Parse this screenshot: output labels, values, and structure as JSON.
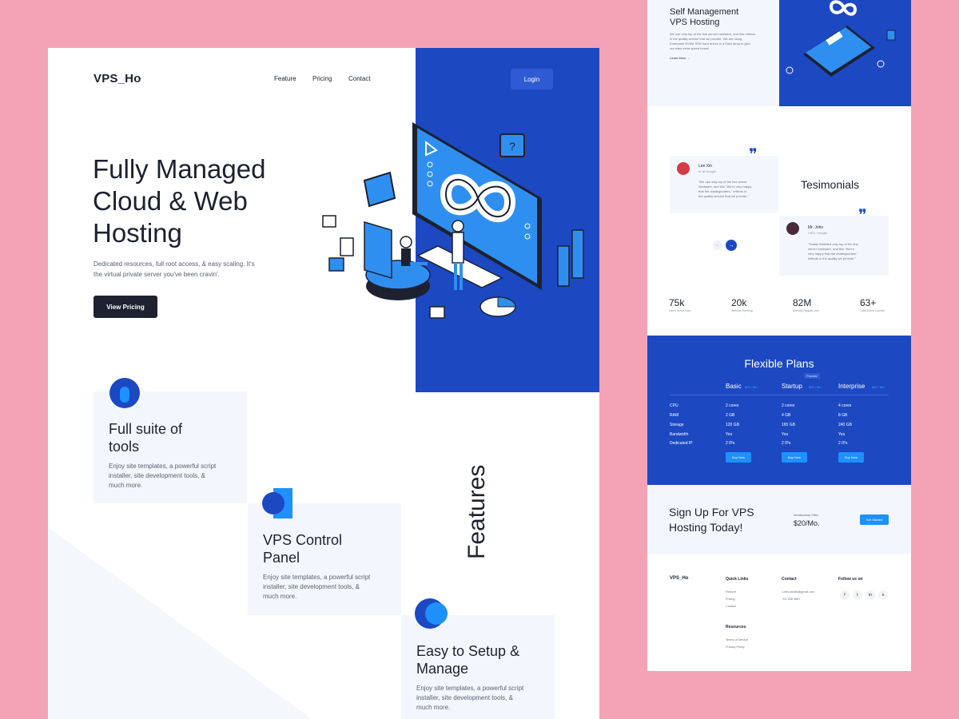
{
  "left": {
    "logo": "VPS_Ho",
    "nav": [
      "Feature",
      "Pricing",
      "Contact"
    ],
    "login": "Login",
    "hero": {
      "title_lines": [
        "Fully Managed",
        "Cloud & Web",
        "Hosting"
      ],
      "desc_lines": [
        "Dedicated resources, full root access, & easy scaling. It's",
        "the virtual private server you've been cravin'."
      ],
      "button": "View Pricing"
    },
    "features_heading": "Features",
    "features": [
      {
        "title_lines": [
          "Full suite of",
          "tools"
        ],
        "desc_lines": [
          "Enjoy site templates, a powerful script",
          "installer, site development tools, &",
          "much more."
        ],
        "icon": "toolbox-icon"
      },
      {
        "title_lines": [
          "VPS Control",
          "Panel"
        ],
        "desc_lines": [
          "Enjoy site templates, a powerful script",
          "installer, site development tools, &",
          "much more."
        ],
        "icon": "control-panel-icon"
      },
      {
        "title_lines": [
          "Easy to Setup &",
          "Manage"
        ],
        "desc_lines": [
          "Enjoy site templates, a powerful script",
          "installer, site development tools, &",
          "much more."
        ],
        "icon": "setup-icon"
      }
    ]
  },
  "right": {
    "self_mgmt": {
      "title_lines": [
        "Self Management",
        "VPS Hosting"
      ],
      "desc_lines": [
        "We use only top of the line server hardware, and this reflects",
        "in the quality service that we provide. We are using",
        "Enterprise NVMe SSD hard drives in a Raid array to give",
        "our sites extra speed boost!"
      ],
      "link": "Learn More"
    },
    "testimonials": {
      "heading": "Tesimonials",
      "items": [
        {
          "name": "Lee Xin",
          "role": "hr at Google",
          "text_lines": [
            "\"We use only top of the line server",
            "hardware, and this \"We're very happy",
            "that the challegnorters.\" reflects in",
            "the quality service that we provide.\""
          ]
        },
        {
          "name": "Mr. John",
          "role": "CEO, Google",
          "text_lines": [
            "\"Totally Satisfied only top of the line",
            "server hardware, and this \"We're",
            "very happy that the challegnorters.\"",
            "reflects in the quality we provide.\""
          ]
        }
      ]
    },
    "stats": [
      {
        "value": "75k",
        "label": "Users Active Now"
      },
      {
        "value": "20k",
        "label": "Website Running"
      },
      {
        "value": "82M",
        "label": "Monthly Regular visit"
      },
      {
        "value": "63+",
        "label": "Total Active Country"
      }
    ],
    "plans": {
      "heading": "Flexible Plans",
      "popular": "Popular",
      "columns": [
        {
          "name": "Basic",
          "price": "$20 / Mo."
        },
        {
          "name": "Startup",
          "price": "$30 / Mo."
        },
        {
          "name": "Interprise",
          "price": "$40 / Mo."
        }
      ],
      "rows": [
        {
          "label": "CPU",
          "values": [
            "2 cores",
            "2 cores",
            "4 cores"
          ]
        },
        {
          "label": "RAM",
          "values": [
            "2 GB",
            "4 GB",
            "8 GB"
          ]
        },
        {
          "label": "Storage",
          "values": [
            "120 GB",
            "165 GB",
            "240 GB"
          ]
        },
        {
          "label": "Bandwidth",
          "values": [
            "Yes",
            "Yes",
            "Yes"
          ]
        },
        {
          "label": "Dedicated IP",
          "values": [
            "2 IPs",
            "2 IPs",
            "2 IPs"
          ]
        }
      ],
      "buy": "Buy Now"
    },
    "signup": {
      "title_lines": [
        "Sign Up For VPS",
        "Hosting Today!"
      ],
      "offer_label": "Introductory Offer",
      "offer_price": "$20/Mo.",
      "button": "Get Started"
    },
    "footer": {
      "logo": "VPS_Ho",
      "quick_links": {
        "heading": "Quick Links",
        "items": [
          "Feature",
          "Pricing",
          "Contact"
        ]
      },
      "contact": {
        "heading": "Contact",
        "items": [
          "1.bes.tamils@gmail.com",
          "+01 555 4567"
        ]
      },
      "follow": {
        "heading": "Follow us on",
        "icons": [
          "facebook-icon",
          "twitter-icon",
          "linkedin-icon",
          "skype-icon"
        ]
      },
      "resources": {
        "heading": "Resources",
        "items": [
          "Terms of Service",
          "Privacy Policy"
        ]
      }
    }
  },
  "colors": {
    "background": "#f4a3b6",
    "primary": "#1c48c2",
    "accent": "#1e90ff",
    "dark": "#1d2130",
    "card": "#f3f7fd"
  }
}
